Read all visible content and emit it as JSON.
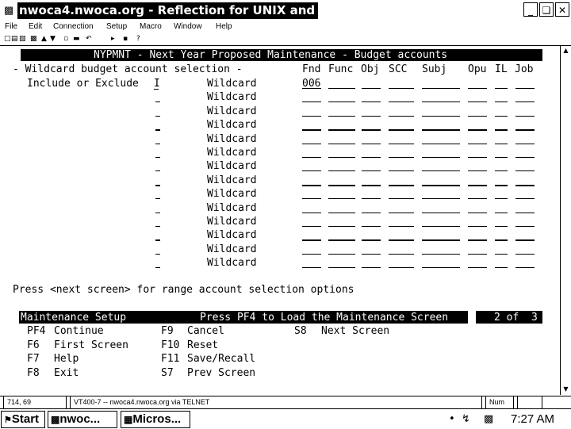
{
  "window": {
    "title": "nwoca4.nwoca.org - Reflection for UNIX and",
    "icons": {
      "app": "terminal-app-icon",
      "minimize": "minimize-icon",
      "restore": "restore-icon",
      "close": "close-icon"
    }
  },
  "menu": {
    "items": [
      "File",
      "Edit",
      "Connection",
      "Setup",
      "Macro",
      "Window",
      "Help"
    ]
  },
  "toolbar": {
    "icons": [
      "new-icon",
      "open-icon",
      "save-icon",
      "print-icon",
      "connect-icon",
      "disconnect-icon",
      "copy-icon",
      "paste-icon",
      "undo-icon",
      "play-icon",
      "stop-icon",
      "help-icon"
    ]
  },
  "terminal": {
    "header": "NYPMNT - Next Year Proposed Maintenance - Budget accounts",
    "section_label": "- Wildcard budget account selection -",
    "include_label": "Include or Exclude",
    "include_value": "I",
    "columns": [
      "Fnd",
      "Func",
      "Obj",
      "SCC",
      "Subj",
      "Opu",
      "IL",
      "Job"
    ],
    "wildcard_label": "Wildcard",
    "first_fund_value": "006",
    "row_count": 14,
    "hint": "Press <next screen> for range account selection options",
    "footer_title": "Maintenance Setup",
    "footer_message": "Press PF4 to Load the Maintenance Screen",
    "page_indicator": "2 of  3",
    "function_keys": {
      "col1": [
        {
          "key": "PF4",
          "label": "Continue"
        },
        {
          "key": "F6",
          "label": "First Screen"
        },
        {
          "key": "F7",
          "label": "Help"
        },
        {
          "key": "F8",
          "label": "Exit"
        }
      ],
      "col2": [
        {
          "key": "F9",
          "label": "Cancel"
        },
        {
          "key": "F10",
          "label": "Reset"
        },
        {
          "key": "F11",
          "label": "Save/Recall"
        },
        {
          "key": "S7",
          "label": "Prev Screen"
        }
      ],
      "col3": [
        {
          "key": "S8",
          "label": "Next Screen"
        }
      ]
    }
  },
  "statusbar": {
    "cursor": "714, 69",
    "connection": "VT400-7 -- nwoca4.nwoca.org via TELNET",
    "num": "Num"
  },
  "taskbar": {
    "start_label": "Start",
    "tasks": [
      {
        "label": "nwoc...",
        "icon": "terminal-app-icon"
      },
      {
        "label": "Micros...",
        "icon": "document-icon"
      }
    ],
    "clock": "7:27 AM",
    "tray_icons": [
      "speaker-icon",
      "network-icon",
      "task-scheduler-icon"
    ]
  }
}
